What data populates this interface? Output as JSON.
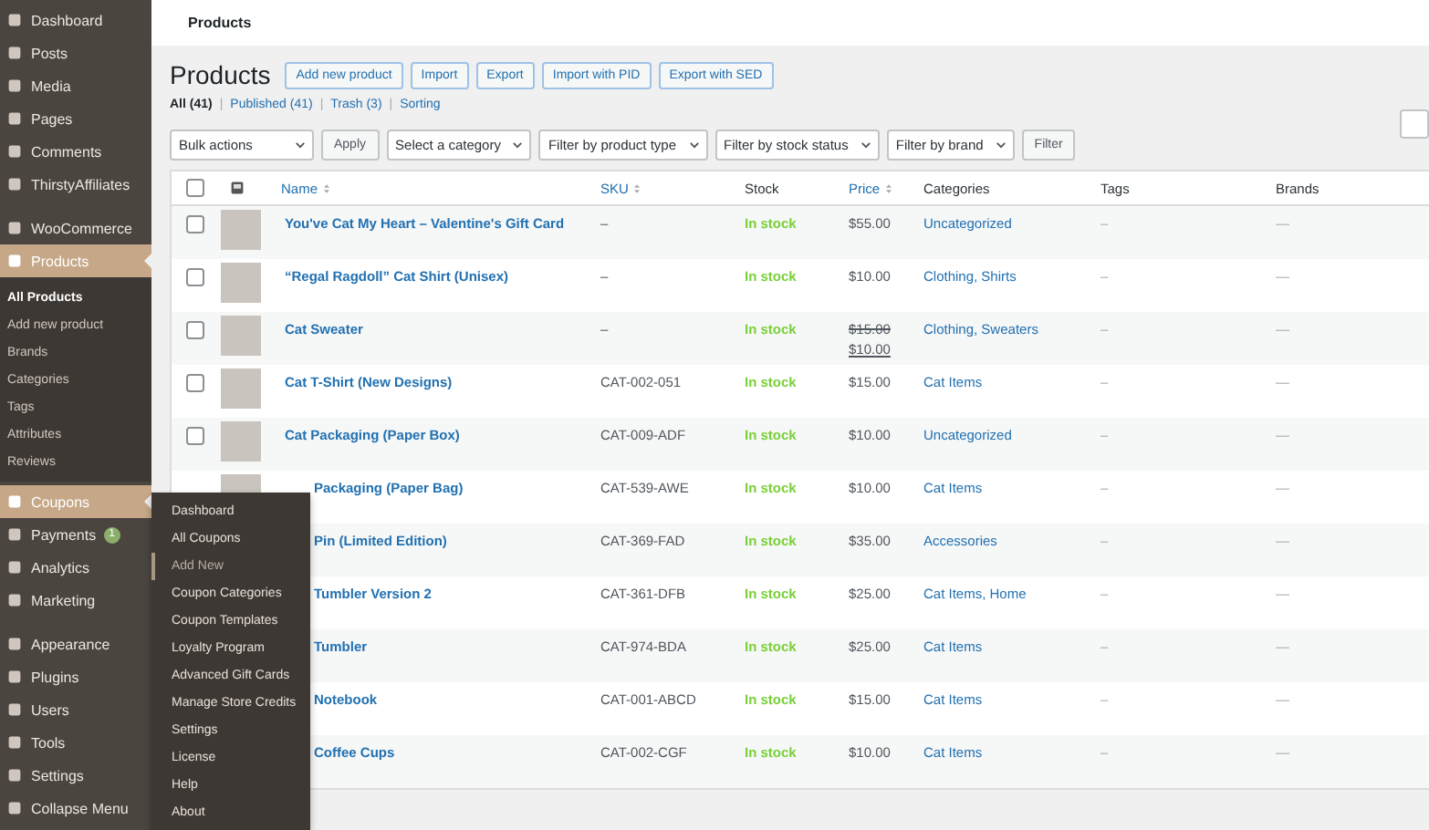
{
  "sidebar": {
    "sections": [
      {
        "items": [
          {
            "label": "Dashboard",
            "selected": false
          },
          {
            "label": "Posts",
            "selected": false
          },
          {
            "label": "Media",
            "selected": false
          },
          {
            "label": "Pages",
            "selected": false
          },
          {
            "label": "Comments",
            "selected": false
          },
          {
            "label": "ThirstyAffiliates",
            "selected": false
          }
        ]
      },
      {
        "items": [
          {
            "label": "WooCommerce",
            "selected": false
          },
          {
            "label": "Products",
            "selected": true,
            "children": [
              {
                "label": "All Products",
                "selected": true
              },
              {
                "label": "Add new product",
                "selected": false
              },
              {
                "label": "Brands",
                "selected": false
              },
              {
                "label": "Categories",
                "selected": false
              },
              {
                "label": "Tags",
                "selected": false
              },
              {
                "label": "Attributes",
                "selected": false
              },
              {
                "label": "Reviews",
                "selected": false
              }
            ]
          },
          {
            "label": "Coupons",
            "selected": true
          },
          {
            "label": "Payments",
            "selected": false,
            "badge": "1"
          },
          {
            "label": "Analytics",
            "selected": false
          },
          {
            "label": "Marketing",
            "selected": false
          }
        ]
      },
      {
        "items": [
          {
            "label": "Appearance",
            "selected": false
          },
          {
            "label": "Plugins",
            "selected": false
          },
          {
            "label": "Users",
            "selected": false
          },
          {
            "label": "Tools",
            "selected": false
          },
          {
            "label": "Settings",
            "selected": false
          },
          {
            "label": "Collapse Menu",
            "selected": false
          }
        ]
      }
    ]
  },
  "flyout": {
    "items": [
      {
        "label": "Dashboard",
        "selected": false
      },
      {
        "label": "All Coupons",
        "selected": false
      },
      {
        "label": "Add New",
        "selected": true
      },
      {
        "label": "Coupon Categories",
        "selected": false
      },
      {
        "label": "Coupon Templates",
        "selected": false
      },
      {
        "label": "Loyalty Program",
        "selected": false
      },
      {
        "label": "Advanced Gift Cards",
        "selected": false
      },
      {
        "label": "Manage Store Credits",
        "selected": false
      },
      {
        "label": "Settings",
        "selected": false
      },
      {
        "label": "License",
        "selected": false
      },
      {
        "label": "Help",
        "selected": false
      },
      {
        "label": "About",
        "selected": false
      }
    ]
  },
  "top_bar": {
    "title": "Products"
  },
  "page": {
    "title": "Products",
    "buttons": [
      "Add new product",
      "Import",
      "Export",
      "Import with PID",
      "Export with SED"
    ],
    "views": [
      {
        "label": "All",
        "count": "(41)",
        "selected": true
      },
      {
        "label": "Published",
        "count": "(41)",
        "selected": false
      },
      {
        "label": "Trash",
        "count": "(3)",
        "selected": false
      },
      {
        "label": "Sorting",
        "selected": false
      }
    ],
    "view_separator": "|",
    "filters": [
      {
        "kind": "select",
        "label": "Bulk actions"
      },
      {
        "kind": "button",
        "label": "Apply"
      },
      {
        "kind": "select",
        "label": "Select a category"
      },
      {
        "kind": "select",
        "label": "Filter by product type"
      },
      {
        "kind": "select",
        "label": "Filter by stock status"
      },
      {
        "kind": "select",
        "label": "Filter by brand"
      },
      {
        "kind": "button",
        "label": "Filter"
      }
    ]
  },
  "table": {
    "select_all": {
      "checked": false
    },
    "columns": [
      {
        "label": "Name",
        "sortable": true
      },
      {
        "label": "SKU",
        "sortable": true
      },
      {
        "label": "Stock",
        "sortable": false
      },
      {
        "label": "Price",
        "sortable": true
      },
      {
        "label": "Categories",
        "sortable": false
      },
      {
        "label": "Tags",
        "sortable": false
      },
      {
        "label": "Brands",
        "sortable": false
      }
    ],
    "rows": [
      {
        "name": "You've Cat My Heart – Valentine's Gift Card",
        "sku": "–",
        "stock": "In stock",
        "price": "$55.00",
        "categories": "Uncategorized",
        "tags": "–",
        "brands": "—",
        "checked": false,
        "partly_hidden": false
      },
      {
        "name": "“Regal Ragdoll” Cat Shirt (Unisex)",
        "sku": "–",
        "stock": "In stock",
        "price": "$10.00",
        "categories": "Clothing, Shirts",
        "tags": "–",
        "brands": "—",
        "checked": false,
        "partly_hidden": false
      },
      {
        "name": "Cat Sweater",
        "sku": "–",
        "stock": "In stock",
        "price": "$15.00",
        "sale_price": "$10.00",
        "categories": "Clothing, Sweaters",
        "tags": "–",
        "brands": "—",
        "checked": false,
        "partly_hidden": false
      },
      {
        "name": "Cat T-Shirt (New Designs)",
        "sku": "CAT-002-051",
        "stock": "In stock",
        "price": "$15.00",
        "categories": "Cat Items",
        "tags": "–",
        "brands": "—",
        "checked": false,
        "partly_hidden": false
      },
      {
        "name": "Cat Packaging (Paper Box)",
        "sku": "CAT-009-ADF",
        "stock": "In stock",
        "price": "$10.00",
        "categories": "Uncategorized",
        "tags": "–",
        "brands": "—",
        "checked": false,
        "partly_hidden": false
      },
      {
        "name": "Packaging (Paper Bag)",
        "sku": "CAT-539-AWE",
        "stock": "In stock",
        "price": "$10.00",
        "categories": "Cat Items",
        "tags": "–",
        "brands": "—",
        "partly_hidden": true
      },
      {
        "name": "Pin (Limited Edition)",
        "sku": "CAT-369-FAD",
        "stock": "In stock",
        "price": "$35.00",
        "categories": "Accessories",
        "tags": "–",
        "brands": "—",
        "partly_hidden": true
      },
      {
        "name": "Tumbler Version 2",
        "sku": "CAT-361-DFB",
        "stock": "In stock",
        "price": "$25.00",
        "categories": "Cat Items, Home",
        "tags": "–",
        "brands": "—",
        "partly_hidden": true
      },
      {
        "name": "Tumbler",
        "sku": "CAT-974-BDA",
        "stock": "In stock",
        "price": "$25.00",
        "categories": "Cat Items",
        "tags": "–",
        "brands": "—",
        "partly_hidden": true
      },
      {
        "name": "Notebook",
        "sku": "CAT-001-ABCD",
        "stock": "In stock",
        "price": "$15.00",
        "categories": "Cat Items",
        "tags": "–",
        "brands": "—",
        "partly_hidden": true
      },
      {
        "name": "Coffee Cups",
        "sku": "CAT-002-CGF",
        "stock": "In stock",
        "price": "$10.00",
        "categories": "Cat Items",
        "tags": "–",
        "brands": "—",
        "partly_hidden": true
      }
    ]
  }
}
